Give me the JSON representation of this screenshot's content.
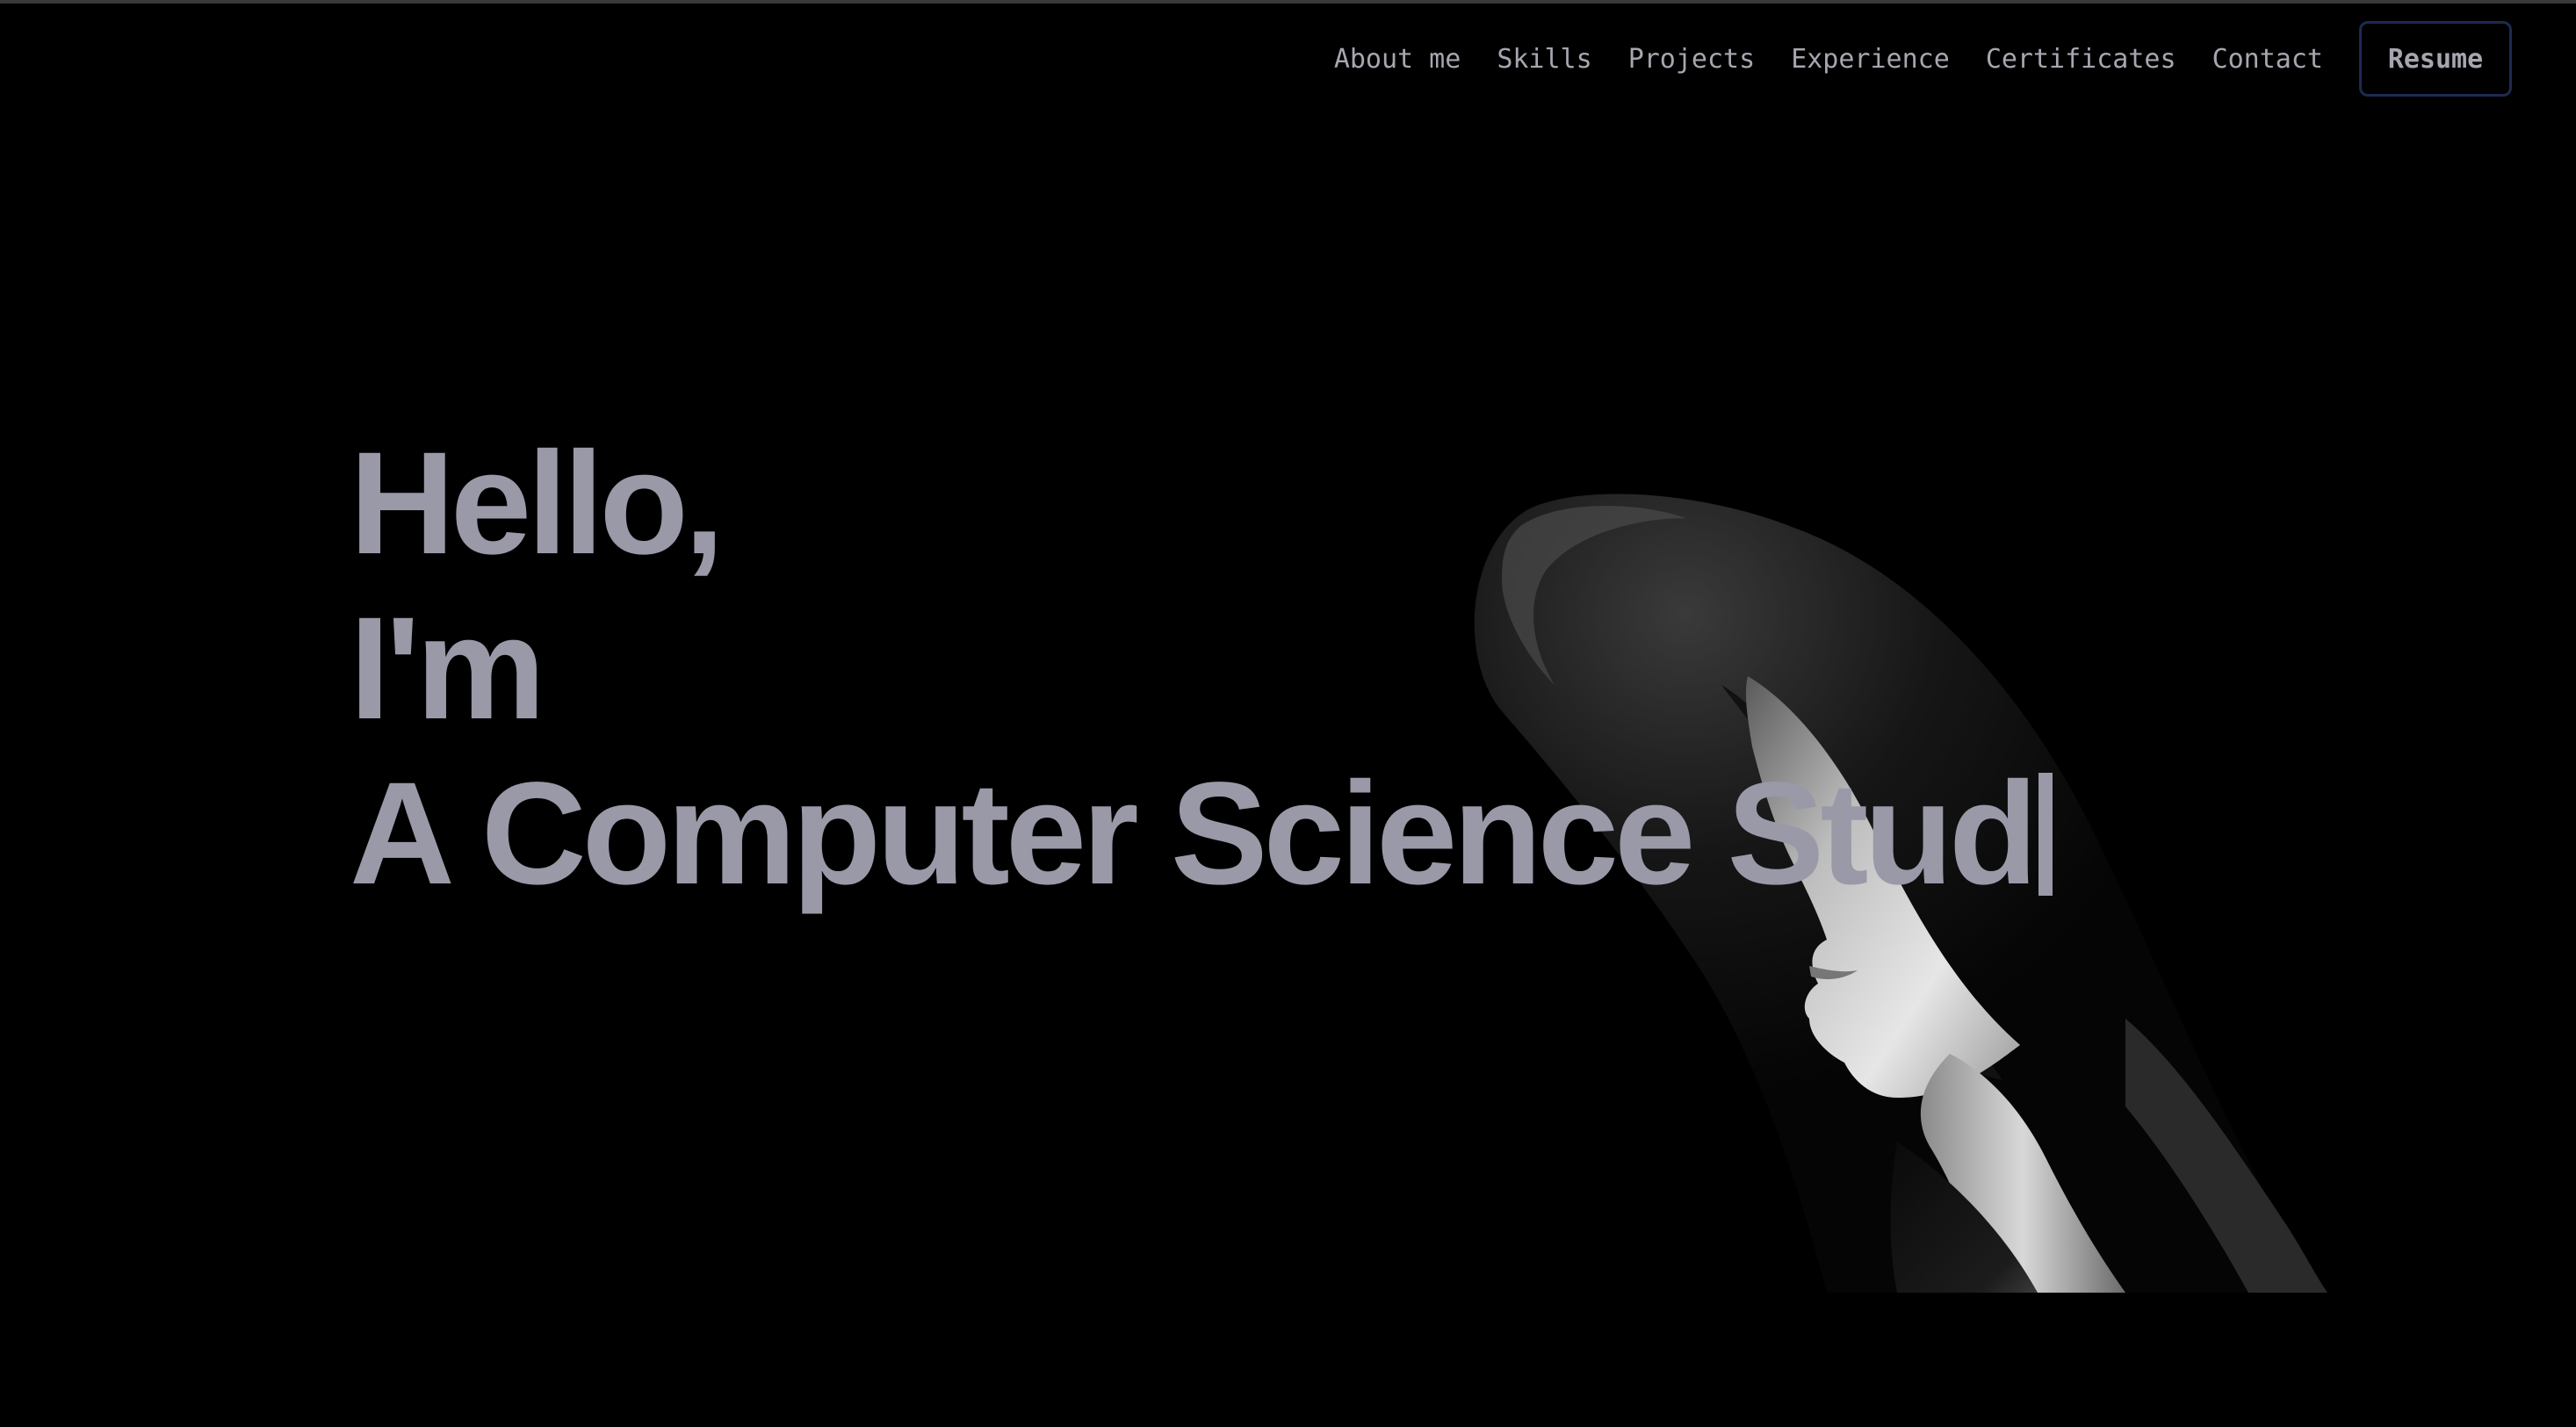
{
  "nav": {
    "links": [
      "About me",
      "Skills",
      "Projects",
      "Experience",
      "Certificates",
      "Contact"
    ],
    "resume_label": "Resume"
  },
  "hero": {
    "greeting": "Hello,",
    "intro": "I'm",
    "typed_text": "A Computer Science Stud"
  },
  "colors": {
    "background": "#000000",
    "hero_text": "#9999a8",
    "nav_text": "#a6a6b0",
    "resume_border": "#1d2a52"
  },
  "icons": {
    "typing_cursor": "text-cursor-icon"
  }
}
